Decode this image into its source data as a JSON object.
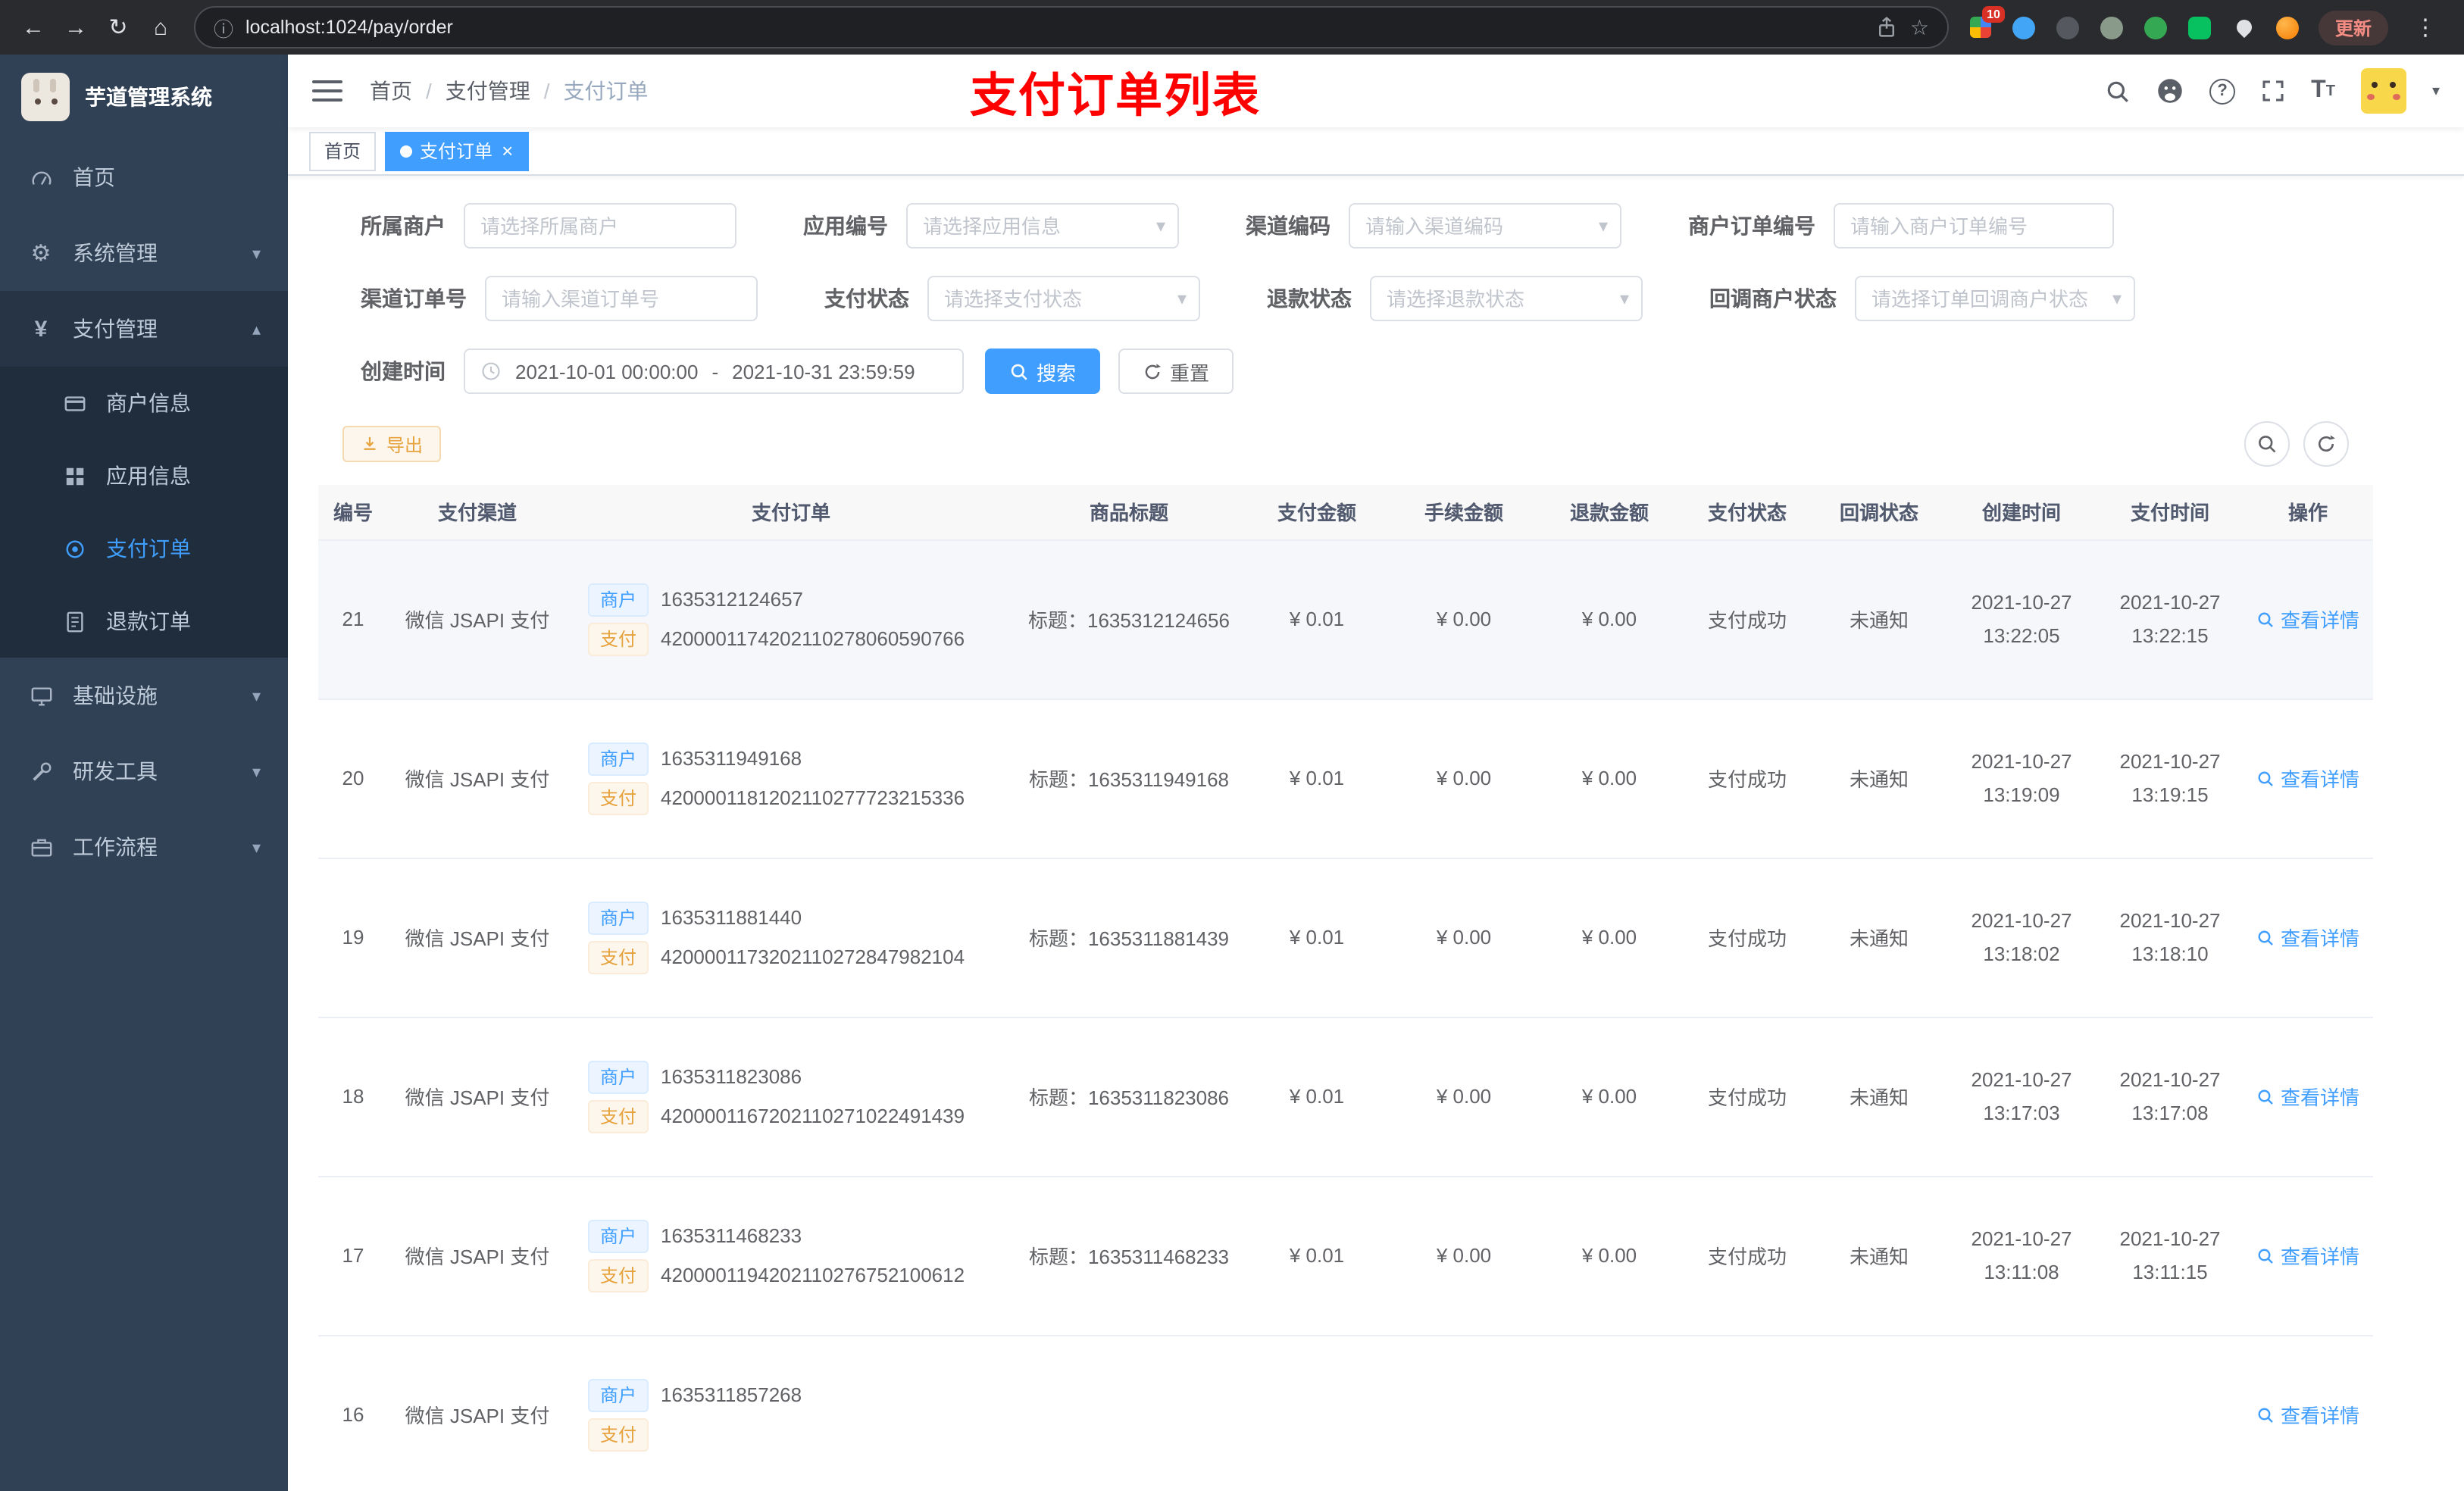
{
  "colors": {
    "primary": "#409EFF",
    "warning": "#E6A23C",
    "annotation_red": "#FF0000",
    "sidebar_bg": "#304156",
    "submenu_bg": "#1F2D3D",
    "active_tag": "#409EFF"
  },
  "icons": {
    "back": "←",
    "forward": "→",
    "reload": "↻",
    "home": "⌂",
    "info": "ⓘ",
    "star": "☆",
    "dots": "⋮",
    "question": "?",
    "gear": "⚙",
    "yen": "¥",
    "chevron_down": "▾",
    "chevron_up": "▴",
    "caret_down": "▾",
    "close": "×",
    "font_large": "T",
    "font_small": "T"
  },
  "browser": {
    "url": "localhost:1024/pay/order",
    "update_label": "更新",
    "extension_badge": "10"
  },
  "sidebar": {
    "title": "芋道管理系统",
    "menu": [
      {
        "label": "首页",
        "icon": "dashboard"
      },
      {
        "label": "系统管理",
        "icon": "gear",
        "expandable": true
      },
      {
        "label": "支付管理",
        "icon": "yen",
        "expandable": true,
        "expanded": true
      },
      {
        "label": "基础设施",
        "icon": "monitor",
        "expandable": true
      },
      {
        "label": "研发工具",
        "icon": "tool",
        "expandable": true
      },
      {
        "label": "工作流程",
        "icon": "briefcase",
        "expandable": true
      }
    ],
    "submenu": [
      {
        "label": "商户信息",
        "icon": "card"
      },
      {
        "label": "应用信息",
        "icon": "grid"
      },
      {
        "label": "支付订单",
        "icon": "target",
        "active": true
      },
      {
        "label": "退款订单",
        "icon": "document"
      }
    ]
  },
  "navbar": {
    "breadcrumb": [
      "首页",
      "支付管理",
      "支付订单"
    ],
    "separator": "/",
    "annotation": "支付订单列表"
  },
  "tags": {
    "home": "首页",
    "active": "支付订单"
  },
  "filters": {
    "row1": [
      {
        "label": "所属商户",
        "placeholder": "请选择所属商户"
      },
      {
        "label": "应用编号",
        "placeholder": "请选择应用信息"
      },
      {
        "label": "渠道编码",
        "placeholder": "请输入渠道编码"
      },
      {
        "label": "商户订单编号",
        "placeholder": "请输入商户订单编号"
      }
    ],
    "row2": [
      {
        "label": "渠道订单号",
        "placeholder": "请输入渠道订单号"
      },
      {
        "label": "支付状态",
        "placeholder": "请选择支付状态"
      },
      {
        "label": "退款状态",
        "placeholder": "请选择退款状态"
      },
      {
        "label": "回调商户状态",
        "placeholder": "请选择订单回调商户状态"
      }
    ],
    "date": {
      "label": "创建时间",
      "start": "2021-10-01 00:00:00",
      "separator": "-",
      "end": "2021-10-31 23:59:59"
    },
    "search_label": "搜索",
    "reset_label": "重置"
  },
  "toolbar": {
    "export_label": "导出"
  },
  "table": {
    "headers": [
      "编号",
      "支付渠道",
      "支付订单",
      "商品标题",
      "支付金额",
      "手续金额",
      "退款金额",
      "支付状态",
      "回调状态",
      "创建时间",
      "支付时间",
      "操作"
    ],
    "tag_merchant": "商户",
    "tag_pay": "支付",
    "action_label": "查看详情",
    "rows": [
      {
        "id": "21",
        "channel": "微信 JSAPI 支付",
        "merchant_no": "1635312124657",
        "pay_no": "4200001174202110278060590766",
        "title": "标题：1635312124656",
        "amount": "¥ 0.01",
        "fee": "¥ 0.00",
        "refund": "¥ 0.00",
        "status": "支付成功",
        "notify": "未通知",
        "created_date": "2021-10-27",
        "created_time": "13:22:05",
        "paid_date": "2021-10-27",
        "paid_time": "13:22:15"
      },
      {
        "id": "20",
        "channel": "微信 JSAPI 支付",
        "merchant_no": "1635311949168",
        "pay_no": "4200001181202110277723215336",
        "title": "标题：1635311949168",
        "amount": "¥ 0.01",
        "fee": "¥ 0.00",
        "refund": "¥ 0.00",
        "status": "支付成功",
        "notify": "未通知",
        "created_date": "2021-10-27",
        "created_time": "13:19:09",
        "paid_date": "2021-10-27",
        "paid_time": "13:19:15"
      },
      {
        "id": "19",
        "channel": "微信 JSAPI 支付",
        "merchant_no": "1635311881440",
        "pay_no": "4200001173202110272847982104",
        "title": "标题：1635311881439",
        "amount": "¥ 0.01",
        "fee": "¥ 0.00",
        "refund": "¥ 0.00",
        "status": "支付成功",
        "notify": "未通知",
        "created_date": "2021-10-27",
        "created_time": "13:18:02",
        "paid_date": "2021-10-27",
        "paid_time": "13:18:10"
      },
      {
        "id": "18",
        "channel": "微信 JSAPI 支付",
        "merchant_no": "1635311823086",
        "pay_no": "4200001167202110271022491439",
        "title": "标题：1635311823086",
        "amount": "¥ 0.01",
        "fee": "¥ 0.00",
        "refund": "¥ 0.00",
        "status": "支付成功",
        "notify": "未通知",
        "created_date": "2021-10-27",
        "created_time": "13:17:03",
        "paid_date": "2021-10-27",
        "paid_time": "13:17:08"
      },
      {
        "id": "17",
        "channel": "微信 JSAPI 支付",
        "merchant_no": "1635311468233",
        "pay_no": "4200001194202110276752100612",
        "title": "标题：1635311468233",
        "amount": "¥ 0.01",
        "fee": "¥ 0.00",
        "refund": "¥ 0.00",
        "status": "支付成功",
        "notify": "未通知",
        "created_date": "2021-10-27",
        "created_time": "13:11:08",
        "paid_date": "2021-10-27",
        "paid_time": "13:11:15"
      },
      {
        "id": "16",
        "channel": "微信 JSAPI 支付",
        "merchant_no": "1635311857268",
        "pay_no": "",
        "title": "",
        "amount": "",
        "fee": "",
        "refund": "",
        "status": "",
        "notify": "",
        "created_date": "",
        "created_time": "",
        "paid_date": "",
        "paid_time": ""
      }
    ]
  }
}
